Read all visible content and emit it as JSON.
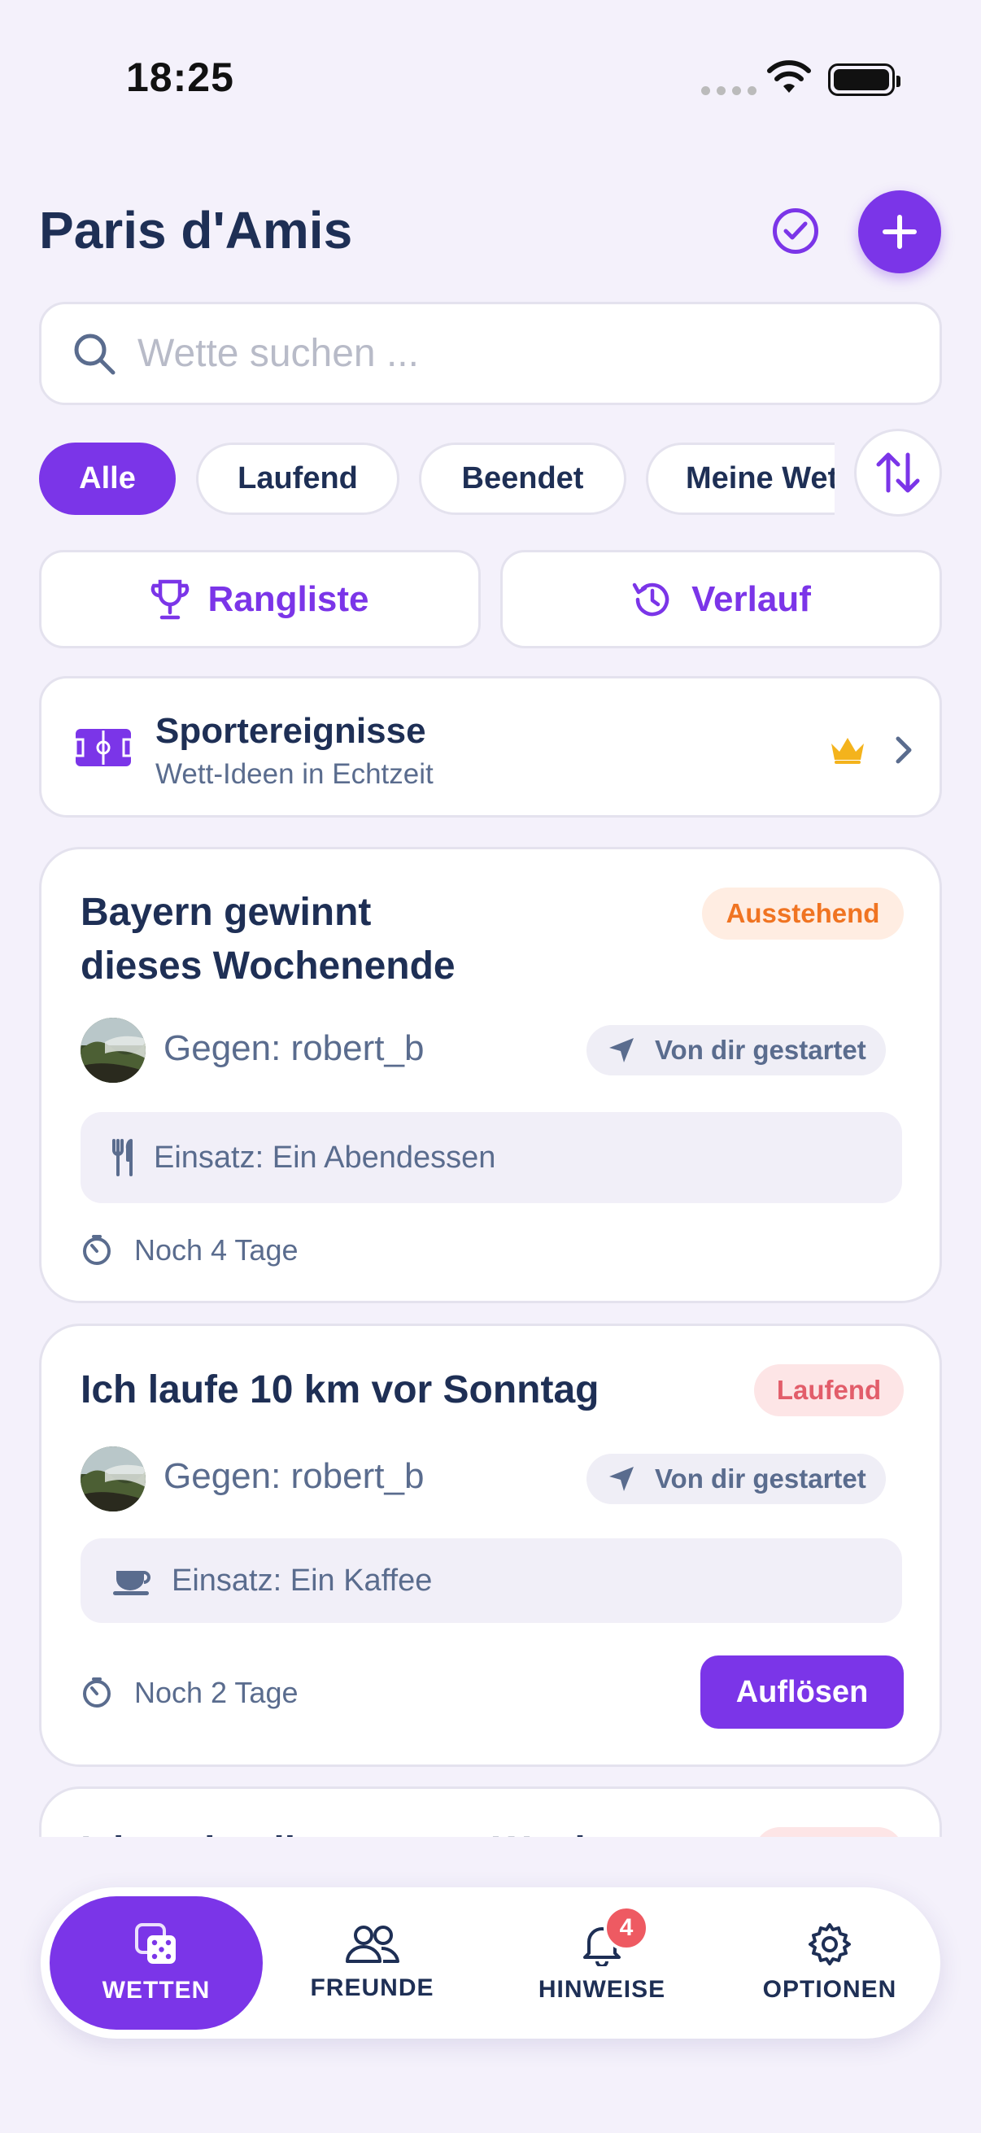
{
  "status_bar": {
    "time": "18:25"
  },
  "header": {
    "title": "Paris d'Amis"
  },
  "search": {
    "placeholder": "Wette suchen ..."
  },
  "filters": [
    {
      "label": "Alle",
      "active": true
    },
    {
      "label": "Laufend",
      "active": false
    },
    {
      "label": "Beendet",
      "active": false
    },
    {
      "label": "Meine Wetten",
      "active": false
    }
  ],
  "actions": {
    "leaderboard": "Rangliste",
    "history": "Verlauf"
  },
  "sport_banner": {
    "title": "Sportereignisse",
    "subtitle": "Wett-Ideen in Echtzeit"
  },
  "bets": [
    {
      "title_line1": "Bayern gewinnt",
      "title_line2": "dieses Wochenende",
      "status": "Ausstehend",
      "opponent": "Gegen: robert_b",
      "started_by": "Von dir gestartet",
      "stake": "Einsatz: Ein Abendessen",
      "remaining": "Noch 4 Tage"
    },
    {
      "title": "Ich laufe 10 km vor Sonntag",
      "status": "Laufend",
      "opponent": "Gegen: robert_b",
      "started_by": "Von dir gestartet",
      "stake": "Einsatz: Ein Kaffee",
      "remaining": "Noch 2 Tage",
      "action": "Auflösen"
    },
    {
      "title": "Ich stehe diese ganze Woche..."
    }
  ],
  "tabbar": {
    "bets": "WETTEN",
    "friends": "FREUNDE",
    "notifications": "HINWEISE",
    "notifications_count": "4",
    "options": "OPTIONEN"
  },
  "colors": {
    "accent": "#7B35E8",
    "text": "#1E2F55",
    "background": "#F4F1FB"
  }
}
